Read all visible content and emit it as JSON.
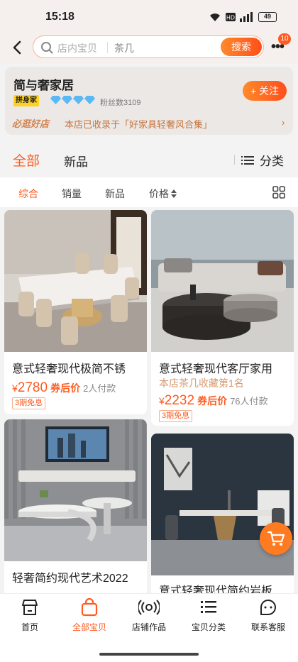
{
  "status_bar": {
    "time": "15:18",
    "battery": "49"
  },
  "search": {
    "placeholder": "店内宝贝",
    "keyword": "茶几",
    "button": "搜索"
  },
  "more": {
    "badge": "10"
  },
  "shop": {
    "name": "简与奢家居",
    "brand_badge": "拼身家",
    "fans": "粉丝数3109",
    "follow_label": "+ 关注",
    "must_visit": "必逛好店",
    "collection_text": "本店已收录于「好家具轻奢风合集」",
    "chevron": "›"
  },
  "tabs": {
    "all": "全部",
    "new": "新品",
    "category": "分类"
  },
  "sort": {
    "items": [
      "综合",
      "销量",
      "新品",
      "价格"
    ]
  },
  "products": [
    {
      "title": "意式轻奢现代极简不锈",
      "price_symbol": "¥",
      "price": "2780",
      "after_coupon": "券后价",
      "buyers": "2人付款",
      "installment": "3期免息"
    },
    {
      "title": "意式轻奢现代客厅家用",
      "subtitle": "本店茶几收藏第1名",
      "price_symbol": "¥",
      "price": "2232",
      "after_coupon": "券后价",
      "buyers": "76人付款",
      "installment": "3期免息"
    },
    {
      "title": "轻奢简约现代艺术2022"
    },
    {
      "title": "意式轻奢现代简约岩板"
    }
  ],
  "bottom_nav": [
    {
      "label": "首页"
    },
    {
      "label": "全部宝贝"
    },
    {
      "label": "店铺作品"
    },
    {
      "label": "宝贝分类"
    },
    {
      "label": "联系客服"
    }
  ],
  "colors": {
    "accent": "#ff5a1f",
    "accent_light": "#ff8a2a",
    "coupon_tag": "#f0b38f"
  },
  "icons": [
    "back-icon",
    "search-icon",
    "more-icon",
    "diamond-icon",
    "list-icon",
    "sort-arrows-icon",
    "grid-icon",
    "cart-icon",
    "shop-home-icon",
    "bag-icon",
    "live-icon",
    "category-icon",
    "service-icon"
  ]
}
